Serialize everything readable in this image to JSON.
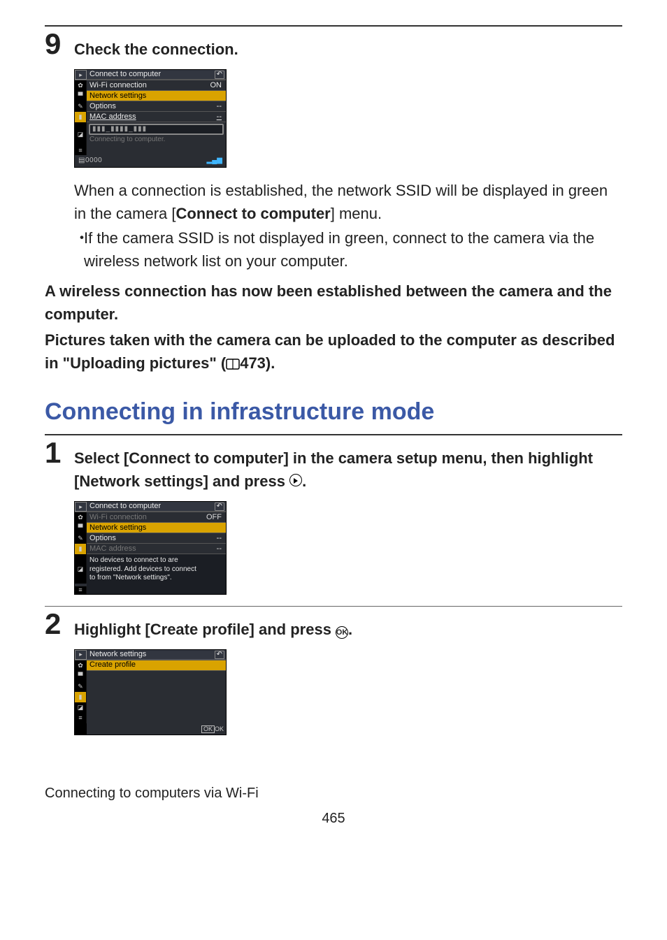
{
  "step9": {
    "num": "9",
    "title": "Check the connection.",
    "cam": {
      "header": "Connect to computer",
      "rows": [
        {
          "label": "Wi-Fi connection",
          "value": "ON",
          "val_class": ""
        },
        {
          "label": "Network settings",
          "value": "--",
          "val_class": "y",
          "hl": true,
          "arrow": true
        },
        {
          "label": "Options",
          "value": "--",
          "val_class": ""
        },
        {
          "label": "MAC address",
          "value": "--",
          "val_class": "",
          "underline": true
        }
      ],
      "ssid_box": "▮▮▮_▮▮▮▮_▮▮▮",
      "connecting": "Connecting to computer.",
      "sd": "0000"
    },
    "para_a": "When a connection is established, the network SSID will be displayed in green in the camera [",
    "para_a_bold": "Connect to computer",
    "para_a_end": "] menu.",
    "bullet_dot": "・",
    "bullet": "If the camera SSID is not displayed in green, connect to the camera via the wireless network list on your computer.",
    "after_a": "A wireless connection has now been established between the camera and the computer.",
    "after_b_1": "Pictures taken with the camera can be uploaded to the computer as described in \"Uploading pictures\" (",
    "after_b_page": "473).",
    "page_icon_alt": "page"
  },
  "section_heading": "Connecting in infrastructure mode",
  "step1": {
    "num": "1",
    "title_a": "Select [Connect to computer] in the camera setup menu, then highlight [Network settings] and press ",
    "title_b": ".",
    "cam": {
      "header": "Connect to computer",
      "rows": [
        {
          "label": "Wi-Fi connection",
          "value": "OFF",
          "val_class": "off",
          "dim": true
        },
        {
          "label": "Network settings",
          "value": "--",
          "val_class": "y",
          "hl": true,
          "arrow": true
        },
        {
          "label": "Options",
          "value": "--",
          "val_class": ""
        },
        {
          "label": "MAC address",
          "value": "--",
          "val_class": "off",
          "dim": true
        }
      ],
      "msg1": "No devices to connect to are",
      "msg2": "registered. Add devices to connect",
      "msg3": "to from \"Network settings\"."
    }
  },
  "step2": {
    "num": "2",
    "title_a": "Highlight [Create profile] and press ",
    "title_b": ".",
    "cam": {
      "header": "Network settings",
      "row_label": "Create profile",
      "ok": "OK"
    }
  },
  "footer": "Connecting to computers via Wi-Fi",
  "page": "465",
  "icons": {
    "play": "▸",
    "camera": "✿",
    "movie": "▝▘",
    "pencil": "✎",
    "antenna": "▮",
    "retouch": "◪",
    "mymenu": "≡",
    "back": "↶",
    "sd": "▤",
    "signal": "▂▄▆"
  }
}
